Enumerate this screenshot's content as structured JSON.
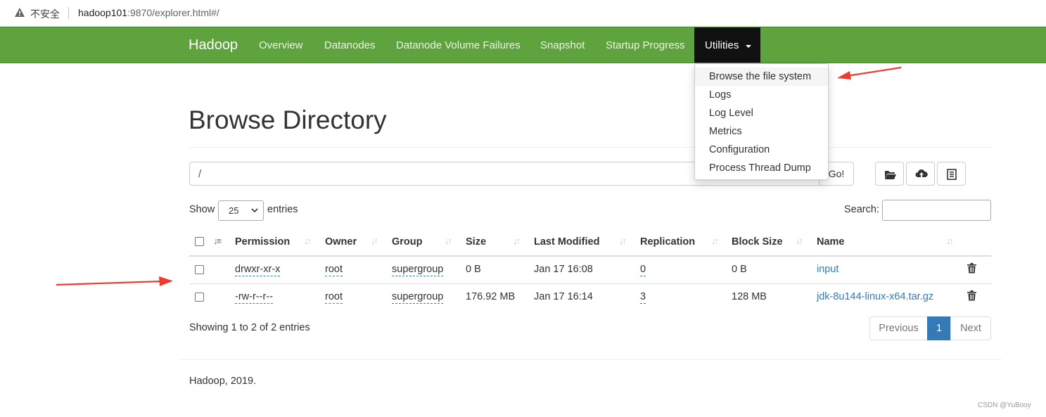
{
  "browser": {
    "security_label": "不安全",
    "url_host": "hadoop101",
    "url_rest": ":9870/explorer.html#/"
  },
  "navbar": {
    "brand": "Hadoop",
    "items": [
      "Overview",
      "Datanodes",
      "Datanode Volume Failures",
      "Snapshot",
      "Startup Progress"
    ],
    "utilities_label": "Utilities",
    "bg_color": "#5fa33e",
    "active_bg_color": "#111111"
  },
  "dropdown": {
    "items": [
      "Browse the file system",
      "Logs",
      "Log Level",
      "Metrics",
      "Configuration",
      "Process Thread Dump"
    ],
    "active_item": "Browse the file system"
  },
  "page": {
    "title": "Browse Directory",
    "path_value": "/",
    "go_label": "Go!",
    "icons": [
      "folder-open-icon",
      "cloud-upload-icon",
      "list-alt-icon"
    ]
  },
  "table_controls": {
    "show_label": "Show",
    "entries_value": "25",
    "entries_label": "entries",
    "search_label": "Search:",
    "search_value": ""
  },
  "table": {
    "columns": [
      "Permission",
      "Owner",
      "Group",
      "Size",
      "Last Modified",
      "Replication",
      "Block Size",
      "Name"
    ],
    "rows": [
      {
        "permission": "drwxr-xr-x",
        "owner": "root",
        "group": "supergroup",
        "size": "0 B",
        "modified": "Jan 17 16:08",
        "replication": "0",
        "block_size": "0 B",
        "name": "input"
      },
      {
        "permission": "-rw-r--r--",
        "owner": "root",
        "group": "supergroup",
        "size": "176.92 MB",
        "modified": "Jan 17 16:14",
        "replication": "3",
        "block_size": "128 MB",
        "name": "jdk-8u144-linux-x64.tar.gz"
      }
    ]
  },
  "pagination": {
    "info": "Showing 1 to 2 of 2 entries",
    "previous": "Previous",
    "current": "1",
    "next": "Next"
  },
  "footer": {
    "text": "Hadoop, 2019."
  },
  "watermark": "CSDN @YuBooy"
}
